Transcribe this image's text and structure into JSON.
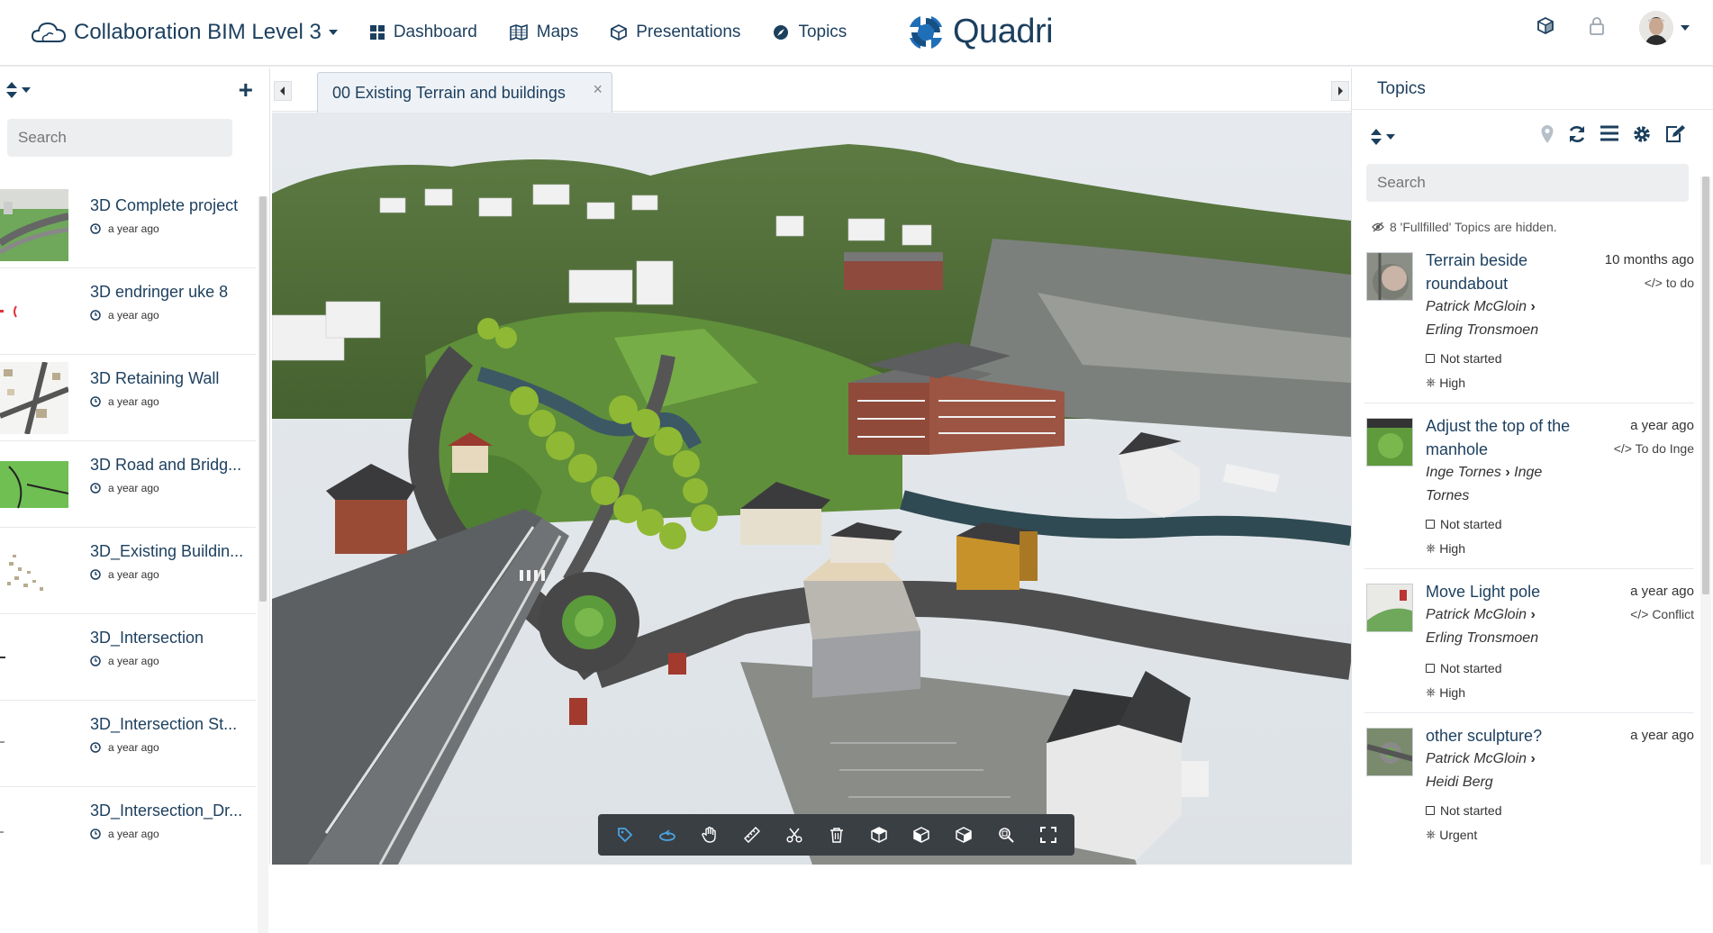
{
  "header": {
    "project_name": "Collaboration BIM Level 3",
    "nav": [
      {
        "label": "Dashboard",
        "icon": "dashboard-grid-icon"
      },
      {
        "label": "Maps",
        "icon": "map-icon"
      },
      {
        "label": "Presentations",
        "icon": "presentation-cube-icon"
      },
      {
        "label": "Topics",
        "icon": "topics-compass-icon"
      }
    ],
    "brand": "Quadri",
    "right_icons": [
      "box-icon",
      "lock-icon",
      "user-avatar"
    ]
  },
  "left_panel": {
    "search_placeholder": "Search",
    "models": [
      {
        "title": "3D Complete project",
        "time": "a year ago"
      },
      {
        "title": "3D endringer uke 8",
        "time": "a year ago"
      },
      {
        "title": "3D Retaining Wall",
        "time": "a year ago"
      },
      {
        "title": "3D Road and Bridg...",
        "time": "a year ago"
      },
      {
        "title": "3D_Existing Buildin...",
        "time": "a year ago"
      },
      {
        "title": "3D_Intersection",
        "time": "a year ago"
      },
      {
        "title": "3D_Intersection St...",
        "time": "a year ago"
      },
      {
        "title": "3D_Intersection_Dr...",
        "time": "a year ago"
      }
    ]
  },
  "tabs": {
    "active": "00 Existing Terrain and buildings",
    "close": "×"
  },
  "toolbar": {
    "tools": [
      "tag-icon",
      "orbit-icon",
      "pan-hand-icon",
      "measure-ruler-icon",
      "cut-scissors-icon",
      "delete-trash-icon",
      "view-cube-top-icon",
      "view-cube-side-icon",
      "view-cube-front-icon",
      "zoom-extent-icon",
      "fullscreen-icon"
    ]
  },
  "right_panel": {
    "title": "Topics",
    "search_placeholder": "Search",
    "hidden_note": "8 'Fullfilled' Topics are hidden.",
    "topics": [
      {
        "title": "Terrain beside roundabout",
        "date": "10 months ago",
        "status": "to do",
        "from": "Patrick McGloin",
        "to": "Erling Tronsmoen",
        "state": "Not started",
        "priority": "High"
      },
      {
        "title": "Adjust the top of the manhole",
        "date": "a year ago",
        "status": "To do Inge",
        "from": "Inge Tornes",
        "to": "Inge Tornes",
        "state": "Not started",
        "priority": "High"
      },
      {
        "title": "Move Light pole",
        "date": "a year ago",
        "status": "Conflict",
        "from": "Patrick McGloin",
        "to": "Erling Tronsmoen",
        "state": "Not started",
        "priority": "High"
      },
      {
        "title": "other sculpture?",
        "date": "a year ago",
        "status": "",
        "from": "Patrick McGloin",
        "to": "Heidi Berg",
        "state": "Not started",
        "priority": "Urgent"
      }
    ]
  },
  "colors": {
    "brand": "#1c3f5e",
    "logo_blue": "#1f6fb8",
    "toolbar_bg": "#3a3f44",
    "tool_blue": "#4aa3e0"
  }
}
